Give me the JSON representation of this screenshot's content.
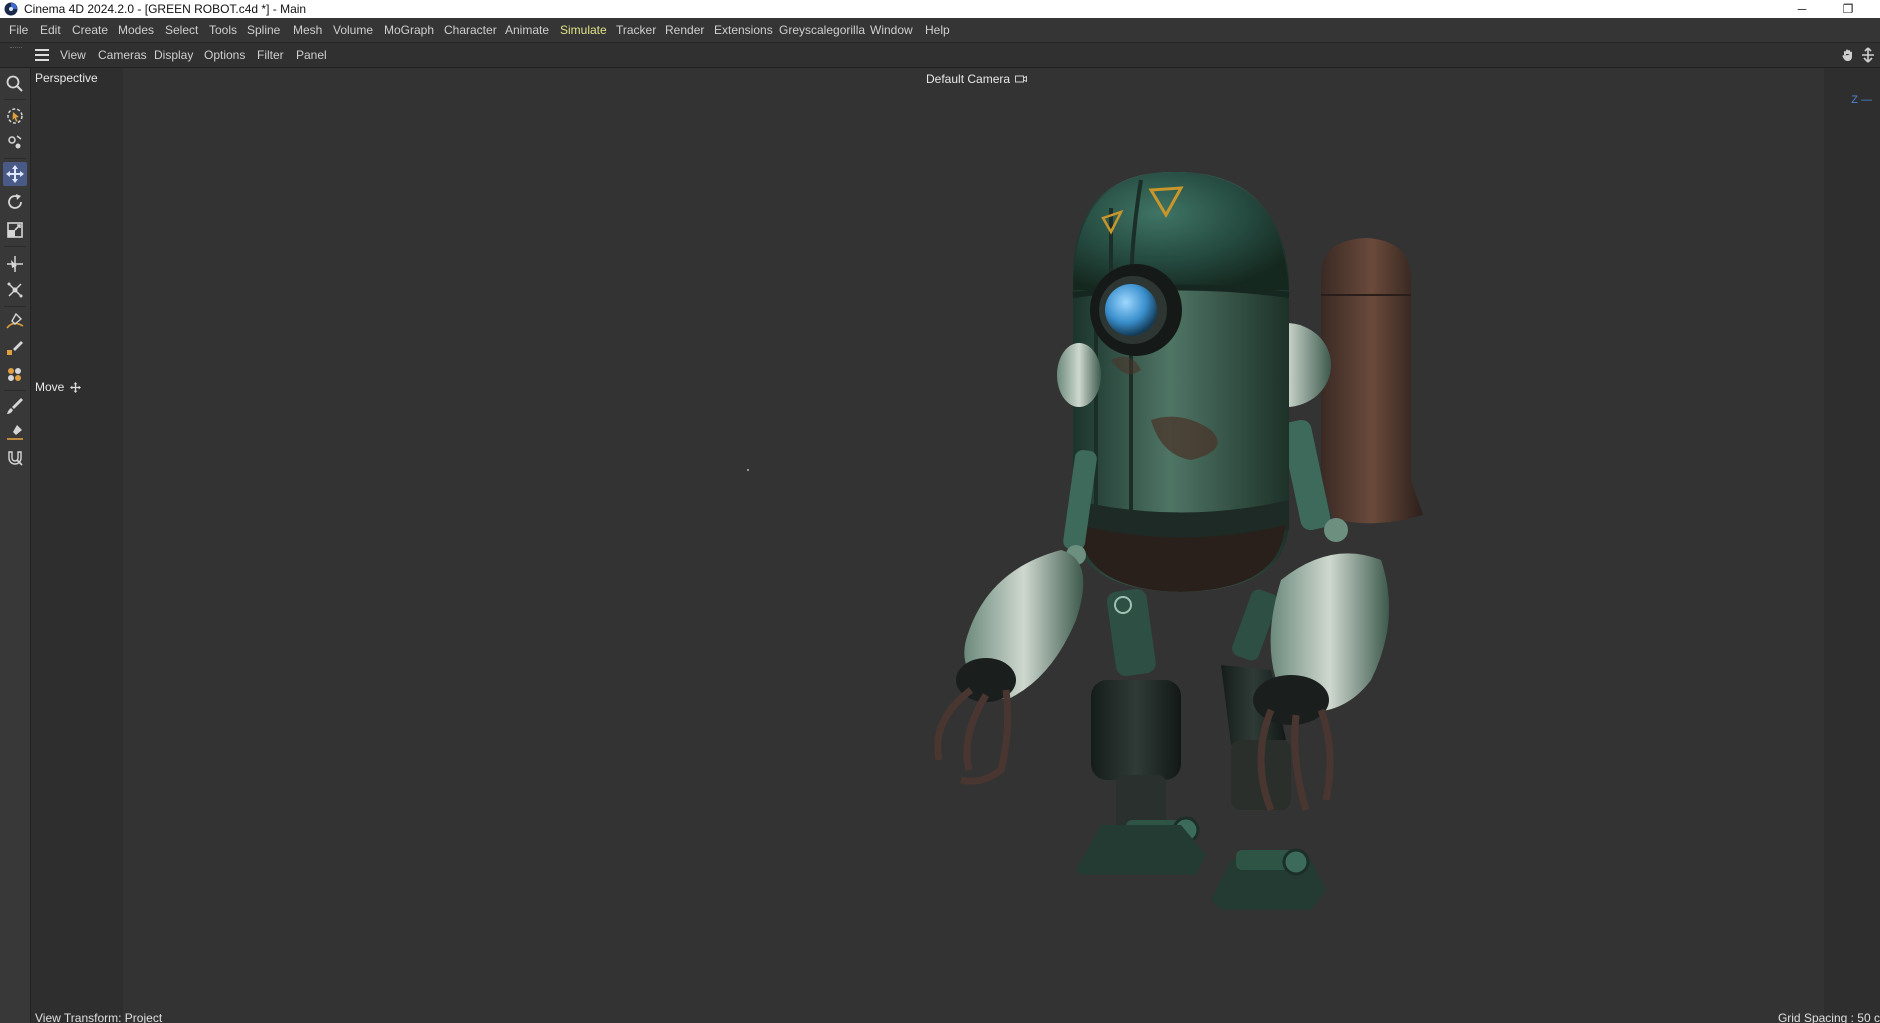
{
  "window": {
    "title": "Cinema 4D 2024.2.0 - [GREEN ROBOT.c4d *] - Main",
    "minimize_glyph": "─",
    "restore_glyph": "❐"
  },
  "menubar": {
    "items": [
      {
        "label": "File"
      },
      {
        "label": "Edit"
      },
      {
        "label": "Create"
      },
      {
        "label": "Modes"
      },
      {
        "label": "Select"
      },
      {
        "label": "Tools"
      },
      {
        "label": "Spline"
      },
      {
        "label": "Mesh"
      },
      {
        "label": "Volume"
      },
      {
        "label": "MoGraph"
      },
      {
        "label": "Character"
      },
      {
        "label": "Animate"
      },
      {
        "label": "Simulate"
      },
      {
        "label": "Tracker"
      },
      {
        "label": "Render"
      },
      {
        "label": "Extensions"
      },
      {
        "label": "Greyscalegorilla"
      },
      {
        "label": "Window"
      },
      {
        "label": "Help"
      }
    ],
    "highlight_color": "#e2e28a"
  },
  "viewbar": {
    "items": [
      {
        "label": "View"
      },
      {
        "label": "Cameras"
      },
      {
        "label": "Display"
      },
      {
        "label": "Options"
      },
      {
        "label": "Filter"
      },
      {
        "label": "Panel"
      }
    ],
    "right_icons": [
      "pan-view-icon",
      "maximize-view-icon"
    ]
  },
  "toolbar": {
    "tools": [
      {
        "icon": "search-icon"
      },
      {
        "icon": "live-selection-icon"
      },
      {
        "icon": "selection-options-icon"
      },
      {
        "icon": "move-icon",
        "active": true
      },
      {
        "icon": "rotate-icon"
      },
      {
        "icon": "scale-icon"
      },
      {
        "icon": "transform-icon"
      },
      {
        "icon": "snap-icon"
      },
      {
        "icon": "spline-pen-icon"
      },
      {
        "icon": "spline-sketch-icon"
      },
      {
        "icon": "knife-icon"
      },
      {
        "icon": "brush-icon"
      },
      {
        "icon": "smooth-brush-icon"
      },
      {
        "icon": "magnet-icon"
      }
    ],
    "active_color": "#4a5a86"
  },
  "viewport": {
    "view_name": "Perspective",
    "camera": "Default Camera",
    "active_tool": "Move",
    "axis_label": "Z",
    "view_transform": "View Transform: Project",
    "grid_spacing": "Grid Spacing : 50 c",
    "background_color": "#333333"
  },
  "scene": {
    "object": "green robot",
    "colors": {
      "body_green": "#2f5b4e",
      "rust": "#5a3a2c",
      "eye_blue": "#4aa0d8",
      "accent_orange": "#c8962a"
    }
  }
}
